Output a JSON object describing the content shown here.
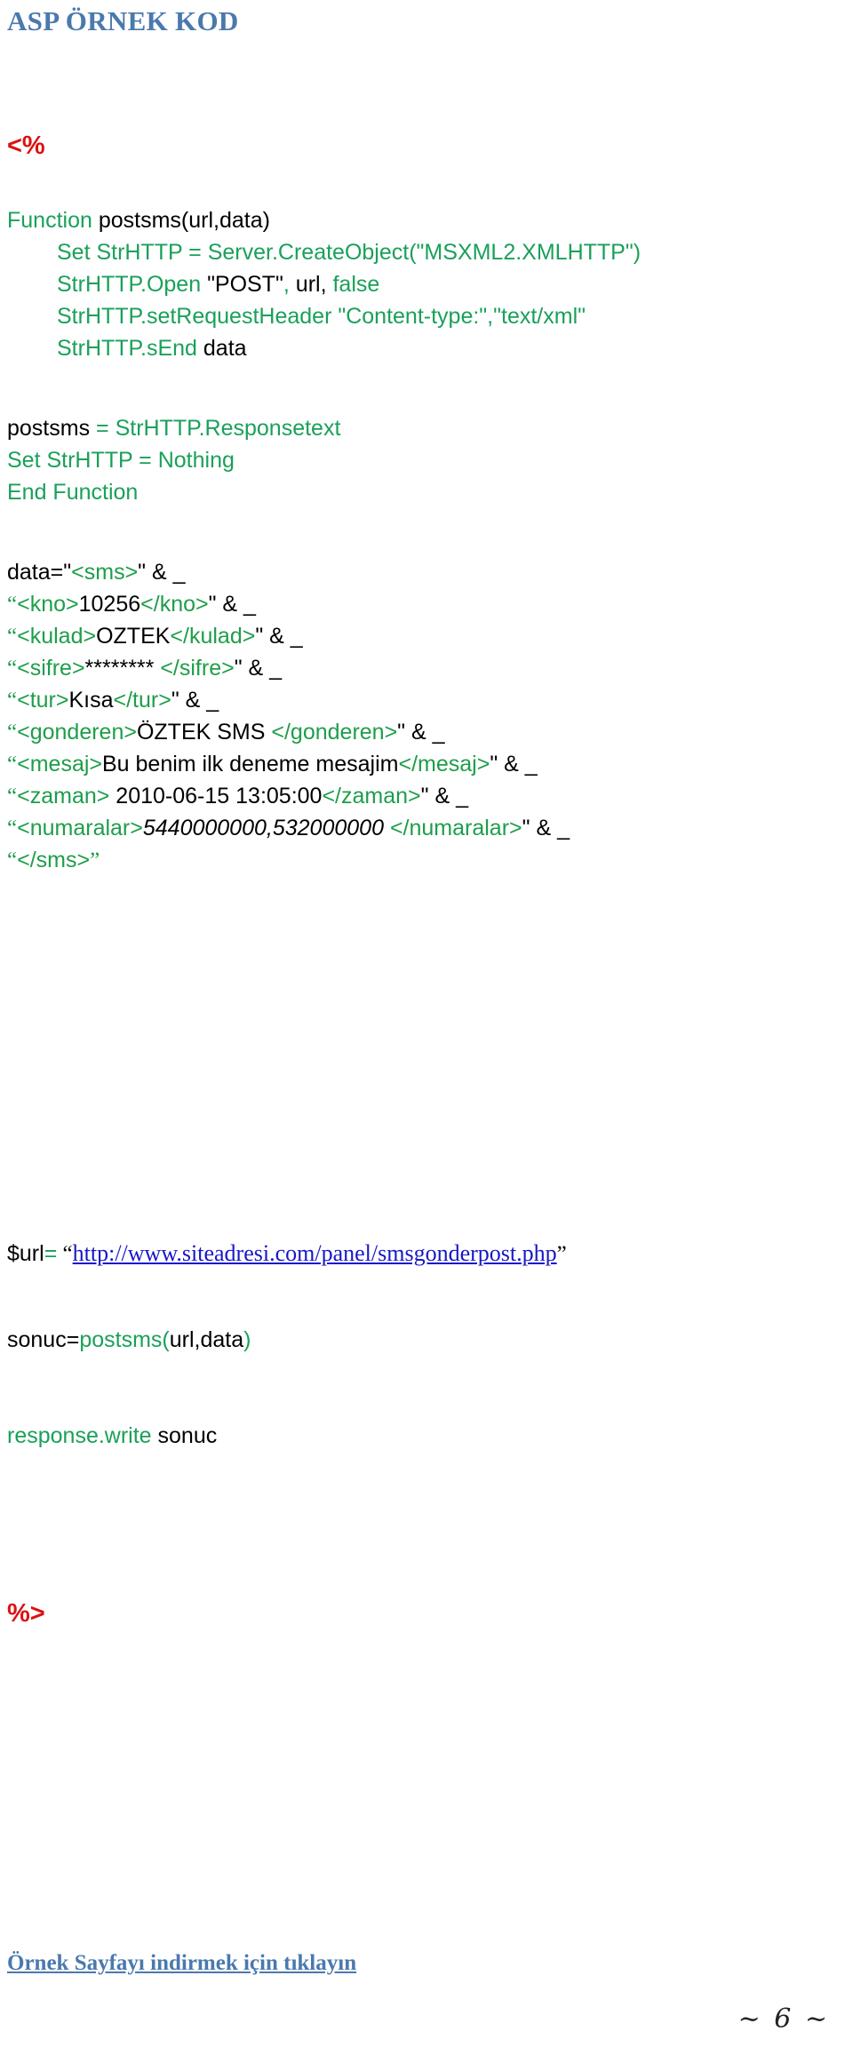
{
  "document": {
    "title": "ASP ÖRNEK KOD",
    "page_number": "~ 6 ~",
    "colors": {
      "title_blue": "#4a79ad",
      "code_green": "#1aa05a",
      "tag_green": "#1e9e4a",
      "delimiter_red": "#dd1111",
      "link_blue": "#1717c8",
      "text_black": "#000000"
    }
  },
  "code": {
    "open_delimiter": "<%",
    "close_delimiter": "%>",
    "function_decl": {
      "keyword": "Function",
      "signature": "postsms(url,data)"
    },
    "body": {
      "line_create_object": "Set StrHTTP = Server.CreateObject(\"MSXML2.XMLHTTP\")",
      "line_open_call": "StrHTTP.Open",
      "line_open_method": "\"POST\"",
      "line_open_comma1": ", ",
      "line_open_url": "url,",
      "line_open_async": " false",
      "line_set_header": "StrHTTP.setRequestHeader \"Content-type:\",\"text/xml\"",
      "line_send_call": "StrHTTP.sEnd",
      "line_send_arg": " data"
    },
    "return_assign": {
      "var": "postsms",
      "expr": " = StrHTTP.Responsetext"
    },
    "line_set_nothing": "Set StrHTTP = Nothing",
    "line_end_function": "End Function"
  },
  "data_block": {
    "lines": [
      {
        "prefix": "data=\"",
        "open_tag": "<sms>",
        "value": "",
        "close_tag": "",
        "suffix": "\" & _"
      },
      {
        "prefix": "“",
        "open_tag": "<kno>",
        "value": "10256",
        "close_tag": "</kno>",
        "suffix": "\" & _"
      },
      {
        "prefix": "“",
        "open_tag": "<kulad>",
        "value": "OZTEK",
        "close_tag": "</kulad>",
        "suffix": "\" & _"
      },
      {
        "prefix": "“",
        "open_tag": "<sifre>",
        "value": "******** ",
        "close_tag": "</sifre>",
        "suffix": "\" & _"
      },
      {
        "prefix": "“",
        "open_tag": "<tur>",
        "value": "Kısa",
        "close_tag": "</tur>",
        "suffix": "\" & _"
      },
      {
        "prefix": "“",
        "open_tag": "<gonderen>",
        "value": "ÖZTEK SMS ",
        "close_tag": "</gonderen>",
        "suffix": "\" & _"
      },
      {
        "prefix": "“",
        "open_tag": "<mesaj>",
        "value": "Bu benim ilk deneme mesajim",
        "close_tag": "</mesaj>",
        "suffix": "\" & _"
      },
      {
        "prefix": "“",
        "open_tag": "<zaman>",
        "value": " 2010-06-15 13:05:00",
        "close_tag": "</zaman>",
        "suffix": "\" & _"
      },
      {
        "prefix": "“",
        "open_tag": "<numaralar>",
        "value": "5440000000,532000000 ",
        "close_tag": "</numaralar>",
        "suffix": "\" & _",
        "italic_value": true
      },
      {
        "prefix": "“",
        "open_tag": "</sms>",
        "value": "",
        "close_tag": "",
        "suffix": "”"
      }
    ]
  },
  "url_line": {
    "var": "$url",
    "equals": "=",
    "quote_open": " “",
    "href_text": "http://www.siteadresi.com/panel/smsgonderpost.php",
    "quote_close": "”"
  },
  "call_line": {
    "prefix": "sonuc=",
    "fn_open": "postsms(",
    "args": "url,data",
    "fn_close": ")"
  },
  "write_line": {
    "keyword": "response.write",
    "arg": " sonuc"
  },
  "footer": {
    "download_link": "Örnek Sayfayı indirmek için tıklayın"
  }
}
